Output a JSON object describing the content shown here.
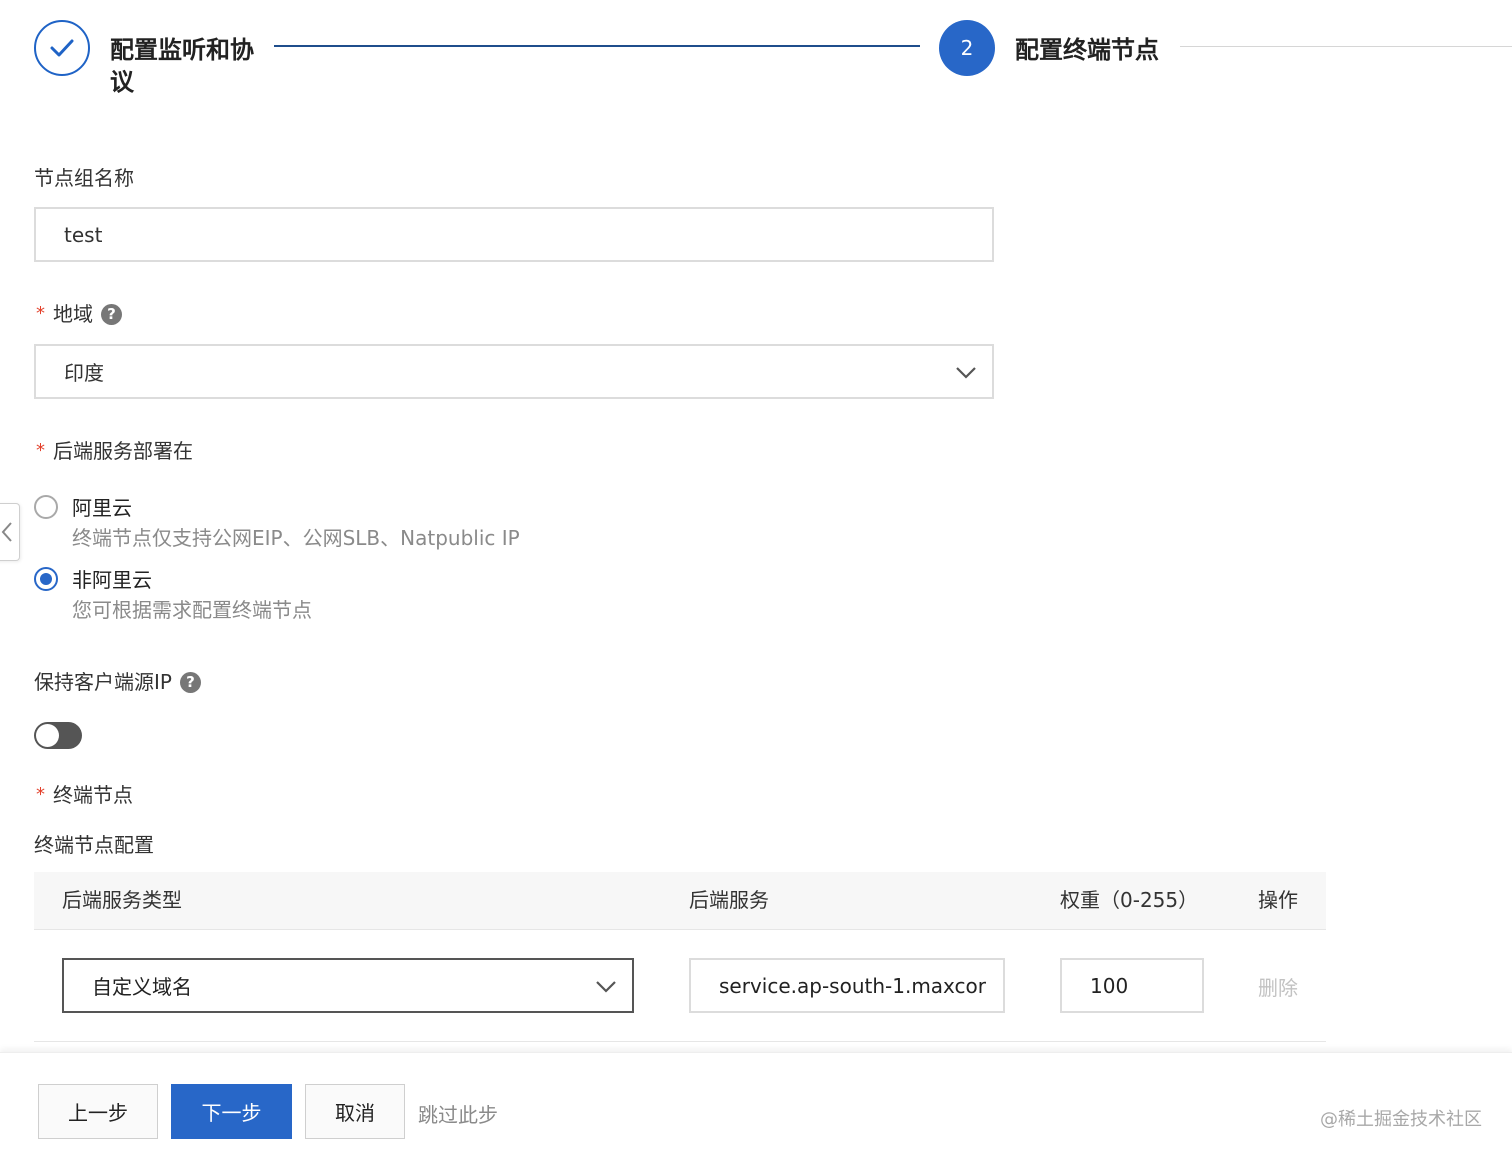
{
  "steps": [
    {
      "title": "配置监听和协议",
      "state": "done"
    },
    {
      "number": "2",
      "title": "配置终端节点",
      "state": "active"
    }
  ],
  "form": {
    "group_name": {
      "label": "节点组名称",
      "value": "test"
    },
    "region": {
      "label": "地域",
      "value": "印度",
      "help_icon": "question-icon"
    },
    "backend_location": {
      "label": "后端服务部署在",
      "options": [
        {
          "label": "阿里云",
          "desc": "终端节点仅支持公网EIP、公网SLB、Natpublic IP",
          "checked": false
        },
        {
          "label": "非阿里云",
          "desc": "您可根据需求配置终端节点",
          "checked": true
        }
      ]
    },
    "keep_client_ip": {
      "label": "保持客户端源IP",
      "enabled": false
    },
    "endpoints": {
      "label": "终端节点",
      "sub_label": "终端节点配置"
    }
  },
  "table": {
    "headers": [
      "后端服务类型",
      "后端服务",
      "权重（0-255）",
      "操作"
    ],
    "rows": [
      {
        "type": "自定义域名",
        "service": "service.ap-south-1.maxcor",
        "weight": "100",
        "action": "删除"
      }
    ]
  },
  "footer": {
    "prev": "上一步",
    "next": "下一步",
    "cancel": "取消",
    "skip": "跳过此步",
    "watermark": "@稀土掘金技术社区"
  },
  "colors": {
    "primary": "#2867c8",
    "required": "#e3402b"
  }
}
